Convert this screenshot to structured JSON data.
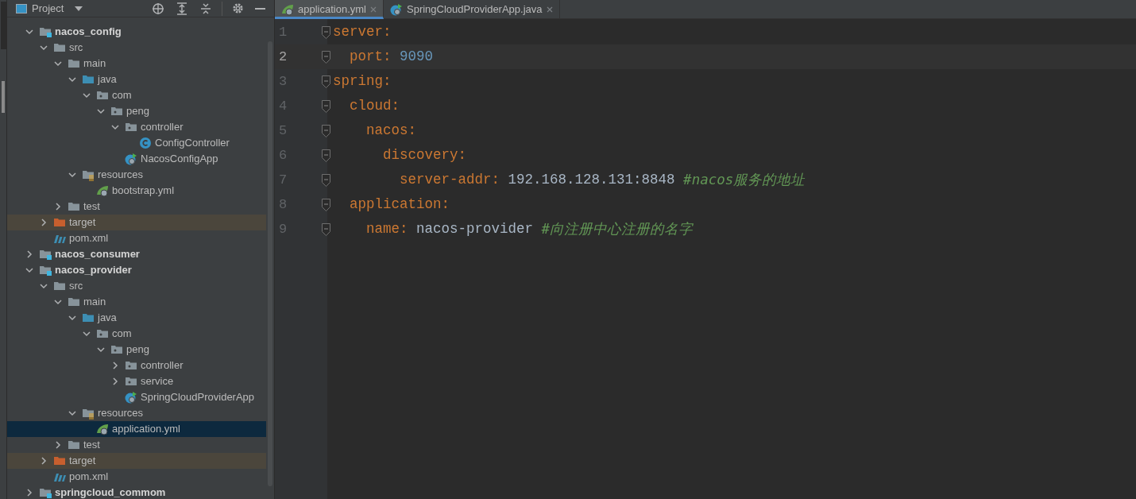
{
  "project_panel": {
    "title": "Project"
  },
  "tree": [
    {
      "label": "nacos_config",
      "kind": "module",
      "expanded": true,
      "selected": false,
      "children": [
        {
          "label": "src",
          "kind": "folder",
          "expanded": true,
          "selected": false,
          "children": [
            {
              "label": "main",
              "kind": "folder",
              "expanded": true,
              "selected": false,
              "children": [
                {
                  "label": "java",
                  "kind": "source",
                  "expanded": true,
                  "selected": false,
                  "children": [
                    {
                      "label": "com",
                      "kind": "package",
                      "expanded": true,
                      "selected": false,
                      "children": [
                        {
                          "label": "peng",
                          "kind": "package",
                          "expanded": true,
                          "selected": false,
                          "children": [
                            {
                              "label": "controller",
                              "kind": "package",
                              "expanded": true,
                              "selected": false,
                              "children": [
                                {
                                  "label": "ConfigController",
                                  "kind": "class",
                                  "selected": false
                                }
                              ]
                            },
                            {
                              "label": "NacosConfigApp",
                              "kind": "app",
                              "selected": false
                            }
                          ]
                        }
                      ]
                    }
                  ]
                },
                {
                  "label": "resources",
                  "kind": "resources",
                  "expanded": true,
                  "selected": false,
                  "children": [
                    {
                      "label": "bootstrap.yml",
                      "kind": "yml",
                      "selected": false
                    }
                  ]
                }
              ]
            },
            {
              "label": "test",
              "kind": "folder",
              "expanded": false,
              "selected": false
            }
          ]
        },
        {
          "label": "target",
          "kind": "excluded",
          "expanded": false,
          "selected": false
        },
        {
          "label": "pom.xml",
          "kind": "maven",
          "selected": false
        }
      ]
    },
    {
      "label": "nacos_consumer",
      "kind": "module",
      "expanded": false,
      "selected": false
    },
    {
      "label": "nacos_provider",
      "kind": "module",
      "expanded": true,
      "selected": false,
      "children": [
        {
          "label": "src",
          "kind": "folder",
          "expanded": true,
          "selected": false,
          "children": [
            {
              "label": "main",
              "kind": "folder",
              "expanded": true,
              "selected": false,
              "children": [
                {
                  "label": "java",
                  "kind": "source",
                  "expanded": true,
                  "selected": false,
                  "children": [
                    {
                      "label": "com",
                      "kind": "package",
                      "expanded": true,
                      "selected": false,
                      "children": [
                        {
                          "label": "peng",
                          "kind": "package",
                          "expanded": true,
                          "selected": false,
                          "children": [
                            {
                              "label": "controller",
                              "kind": "package",
                              "expanded": false,
                              "selected": false
                            },
                            {
                              "label": "service",
                              "kind": "package",
                              "expanded": false,
                              "selected": false
                            },
                            {
                              "label": "SpringCloudProviderApp",
                              "kind": "app",
                              "selected": false
                            }
                          ]
                        }
                      ]
                    }
                  ]
                },
                {
                  "label": "resources",
                  "kind": "resources",
                  "expanded": true,
                  "selected": false,
                  "children": [
                    {
                      "label": "application.yml",
                      "kind": "yml",
                      "selected": true
                    }
                  ]
                }
              ]
            },
            {
              "label": "test",
              "kind": "folder",
              "expanded": false,
              "selected": false
            }
          ]
        },
        {
          "label": "target",
          "kind": "excluded",
          "expanded": false,
          "selected": false
        },
        {
          "label": "pom.xml",
          "kind": "maven",
          "selected": false
        }
      ]
    },
    {
      "label": "springcloud_commom",
      "kind": "module",
      "expanded": false,
      "selected": false
    }
  ],
  "tabs": [
    {
      "label": "application.yml",
      "kind": "yml",
      "selected": true,
      "closable": true
    },
    {
      "label": "SpringCloudProviderApp.java",
      "kind": "app",
      "selected": false,
      "closable": true
    }
  ],
  "editor": {
    "lines": [
      {
        "number": "1",
        "current": false,
        "tokens": [
          {
            "kind": "key",
            "text": "server"
          },
          {
            "kind": "punct",
            "text": ":"
          }
        ]
      },
      {
        "number": "2",
        "current": true,
        "tokens": [
          {
            "kind": "key",
            "text": "  port"
          },
          {
            "kind": "punct",
            "text": ": "
          },
          {
            "kind": "number",
            "text": "9090"
          }
        ]
      },
      {
        "number": "3",
        "current": false,
        "tokens": [
          {
            "kind": "key",
            "text": "spring"
          },
          {
            "kind": "punct",
            "text": ":"
          }
        ]
      },
      {
        "number": "4",
        "current": false,
        "tokens": [
          {
            "kind": "key",
            "text": "  cloud"
          },
          {
            "kind": "punct",
            "text": ":"
          }
        ]
      },
      {
        "number": "5",
        "current": false,
        "tokens": [
          {
            "kind": "key",
            "text": "    nacos"
          },
          {
            "kind": "punct",
            "text": ":"
          }
        ]
      },
      {
        "number": "6",
        "current": false,
        "tokens": [
          {
            "kind": "key",
            "text": "      discovery"
          },
          {
            "kind": "punct",
            "text": ":"
          }
        ]
      },
      {
        "number": "7",
        "current": false,
        "tokens": [
          {
            "kind": "key",
            "text": "        server-addr"
          },
          {
            "kind": "punct",
            "text": ": "
          },
          {
            "kind": "value",
            "text": "192.168.128.131:8848 "
          },
          {
            "kind": "comment",
            "text": "#nacos服务的地址"
          }
        ]
      },
      {
        "number": "8",
        "current": false,
        "tokens": [
          {
            "kind": "key",
            "text": "  application"
          },
          {
            "kind": "punct",
            "text": ":"
          }
        ]
      },
      {
        "number": "9",
        "current": false,
        "tokens": [
          {
            "kind": "key",
            "text": "    name"
          },
          {
            "kind": "punct",
            "text": ": "
          },
          {
            "kind": "value",
            "text": "nacos-provider "
          },
          {
            "kind": "comment",
            "text": "#向注册中心注册的名字"
          }
        ]
      }
    ]
  }
}
